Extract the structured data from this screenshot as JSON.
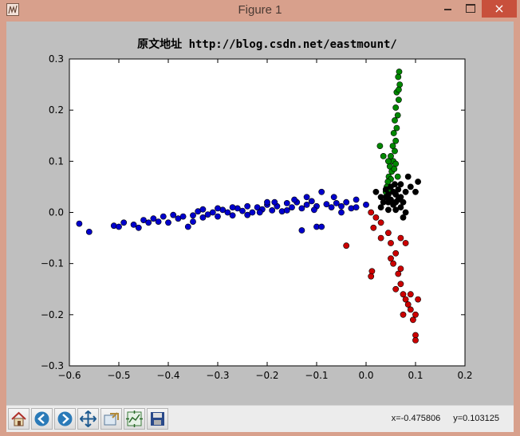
{
  "window": {
    "title": "Figure 1",
    "close_symbol": "×",
    "app_icon": "matplotlib-figure-icon"
  },
  "toolbar": {
    "buttons": [
      {
        "name": "home-button",
        "icon": "home-icon",
        "label": "Home"
      },
      {
        "name": "back-button",
        "icon": "back-arrow-icon",
        "label": "Back"
      },
      {
        "name": "forward-button",
        "icon": "forward-arrow-icon",
        "label": "Forward"
      },
      {
        "name": "pan-button",
        "icon": "pan-arrows-icon",
        "label": "Pan"
      },
      {
        "name": "zoom-button",
        "icon": "zoom-rect-icon",
        "label": "Zoom"
      },
      {
        "name": "subplots-button",
        "icon": "subplots-config-icon",
        "label": "Configure subplots"
      },
      {
        "name": "save-button",
        "icon": "floppy-disk-icon",
        "label": "Save"
      }
    ],
    "coord_x": "x=-0.475806",
    "coord_y": "y=0.103125"
  },
  "chart_data": {
    "type": "scatter",
    "title": "原文地址 http://blog.csdn.net/eastmount/",
    "xlabel": "",
    "ylabel": "",
    "xlim": [
      -0.6,
      0.2
    ],
    "ylim": [
      -0.3,
      0.3
    ],
    "xticks": [
      -0.6,
      -0.5,
      -0.4,
      -0.3,
      -0.2,
      -0.1,
      0.0,
      0.1,
      0.2
    ],
    "xtick_labels": [
      "−0.6",
      "−0.5",
      "−0.4",
      "−0.3",
      "−0.2",
      "−0.1",
      "0.0",
      "0.1",
      "0.2"
    ],
    "yticks": [
      -0.3,
      -0.2,
      -0.1,
      0.0,
      0.1,
      0.2,
      0.3
    ],
    "ytick_labels": [
      "−0.3",
      "−0.2",
      "−0.1",
      "0.0",
      "0.1",
      "0.2",
      "0.3"
    ],
    "grid": false,
    "legend": "none",
    "series": [
      {
        "color": "#0000cc",
        "points": [
          [
            -0.58,
            -0.022
          ],
          [
            -0.56,
            -0.038
          ],
          [
            -0.51,
            -0.026
          ],
          [
            -0.5,
            -0.028
          ],
          [
            -0.49,
            -0.02
          ],
          [
            -0.47,
            -0.024
          ],
          [
            -0.46,
            -0.03
          ],
          [
            -0.45,
            -0.015
          ],
          [
            -0.44,
            -0.02
          ],
          [
            -0.43,
            -0.012
          ],
          [
            -0.42,
            -0.018
          ],
          [
            -0.41,
            -0.008
          ],
          [
            -0.4,
            -0.02
          ],
          [
            -0.39,
            -0.005
          ],
          [
            -0.38,
            -0.012
          ],
          [
            -0.37,
            -0.008
          ],
          [
            -0.36,
            -0.028
          ],
          [
            -0.35,
            -0.006
          ],
          [
            -0.34,
            0.002
          ],
          [
            -0.33,
            -0.01
          ],
          [
            -0.32,
            -0.004
          ],
          [
            -0.31,
            0.0
          ],
          [
            -0.3,
            -0.008
          ],
          [
            -0.29,
            0.005
          ],
          [
            -0.28,
            0.0
          ],
          [
            -0.27,
            -0.006
          ],
          [
            -0.26,
            0.008
          ],
          [
            -0.25,
            0.003
          ],
          [
            -0.24,
            0.012
          ],
          [
            -0.23,
            0.0
          ],
          [
            -0.22,
            0.01
          ],
          [
            -0.21,
            0.006
          ],
          [
            -0.2,
            0.015
          ],
          [
            -0.19,
            0.004
          ],
          [
            -0.18,
            0.012
          ],
          [
            -0.17,
            0.002
          ],
          [
            -0.16,
            0.018
          ],
          [
            -0.15,
            0.01
          ],
          [
            -0.14,
            0.02
          ],
          [
            -0.13,
            0.008
          ],
          [
            -0.12,
            0.015
          ],
          [
            -0.11,
            0.022
          ],
          [
            -0.1,
            0.012
          ],
          [
            -0.09,
            0.04
          ],
          [
            -0.08,
            0.016
          ],
          [
            -0.07,
            0.01
          ],
          [
            -0.06,
            0.018
          ],
          [
            -0.05,
            0.012
          ],
          [
            -0.04,
            0.02
          ],
          [
            -0.03,
            0.008
          ],
          [
            -0.02,
            0.01
          ],
          [
            0.0,
            0.015
          ],
          [
            -0.13,
            -0.035
          ],
          [
            -0.1,
            -0.028
          ],
          [
            -0.09,
            -0.028
          ],
          [
            -0.24,
            -0.005
          ],
          [
            -0.3,
            0.008
          ],
          [
            -0.35,
            -0.018
          ],
          [
            -0.2,
            0.02
          ],
          [
            -0.16,
            0.004
          ],
          [
            -0.12,
            0.03
          ],
          [
            -0.27,
            0.01
          ],
          [
            -0.33,
            0.006
          ],
          [
            -0.05,
            0.0
          ],
          [
            -0.02,
            0.025
          ],
          [
            -0.215,
            0.0
          ],
          [
            -0.185,
            0.02
          ],
          [
            -0.145,
            0.025
          ],
          [
            -0.105,
            0.005
          ],
          [
            -0.065,
            0.03
          ]
        ]
      },
      {
        "color": "#008800",
        "points": [
          [
            0.067,
            0.275
          ],
          [
            0.065,
            0.265
          ],
          [
            0.068,
            0.25
          ],
          [
            0.062,
            0.235
          ],
          [
            0.066,
            0.22
          ],
          [
            0.06,
            0.205
          ],
          [
            0.064,
            0.19
          ],
          [
            0.058,
            0.18
          ],
          [
            0.062,
            0.165
          ],
          [
            0.056,
            0.155
          ],
          [
            0.06,
            0.14
          ],
          [
            0.054,
            0.13
          ],
          [
            0.058,
            0.12
          ],
          [
            0.05,
            0.11
          ],
          [
            0.055,
            0.1
          ],
          [
            0.048,
            0.09
          ],
          [
            0.052,
            0.08
          ],
          [
            0.046,
            0.07
          ],
          [
            0.05,
            0.065
          ],
          [
            0.044,
            0.06
          ],
          [
            0.042,
            0.05
          ],
          [
            0.048,
            0.045
          ],
          [
            0.04,
            0.04
          ],
          [
            0.028,
            0.13
          ],
          [
            0.035,
            0.11
          ],
          [
            0.06,
            0.095
          ],
          [
            0.057,
            0.085
          ],
          [
            0.064,
            0.07
          ],
          [
            0.045,
            0.1
          ],
          [
            0.066,
            0.24
          ]
        ]
      },
      {
        "color": "#000000",
        "points": [
          [
            0.05,
            0.05
          ],
          [
            0.055,
            0.04
          ],
          [
            0.06,
            0.035
          ],
          [
            0.065,
            0.045
          ],
          [
            0.07,
            0.03
          ],
          [
            0.045,
            0.02
          ],
          [
            0.04,
            0.03
          ],
          [
            0.035,
            0.02
          ],
          [
            0.05,
            0.025
          ],
          [
            0.06,
            0.02
          ],
          [
            0.075,
            0.02
          ],
          [
            0.08,
            0.04
          ],
          [
            0.085,
            0.07
          ],
          [
            0.09,
            0.05
          ],
          [
            0.1,
            0.04
          ],
          [
            0.105,
            0.06
          ],
          [
            0.02,
            0.04
          ],
          [
            0.03,
            0.01
          ],
          [
            0.045,
            0.005
          ],
          [
            0.06,
            0.005
          ],
          [
            0.07,
            0.01
          ],
          [
            0.08,
            0.0
          ],
          [
            0.075,
            -0.01
          ],
          [
            0.055,
            0.015
          ],
          [
            0.065,
            0.025
          ],
          [
            0.045,
            0.035
          ],
          [
            0.04,
            0.045
          ],
          [
            0.058,
            0.055
          ],
          [
            0.07,
            0.055
          ],
          [
            0.03,
            0.03
          ]
        ]
      },
      {
        "color": "#cc0000",
        "points": [
          [
            0.01,
            0.0
          ],
          [
            0.02,
            -0.01
          ],
          [
            0.03,
            -0.02
          ],
          [
            0.045,
            -0.04
          ],
          [
            0.05,
            -0.06
          ],
          [
            0.06,
            -0.08
          ],
          [
            0.055,
            -0.1
          ],
          [
            0.065,
            -0.12
          ],
          [
            0.07,
            -0.14
          ],
          [
            0.075,
            -0.16
          ],
          [
            0.08,
            -0.17
          ],
          [
            0.085,
            -0.18
          ],
          [
            0.09,
            -0.19
          ],
          [
            0.1,
            -0.2
          ],
          [
            0.095,
            -0.21
          ],
          [
            0.1,
            -0.24
          ],
          [
            0.1,
            -0.25
          ],
          [
            0.05,
            -0.09
          ],
          [
            0.03,
            -0.05
          ],
          [
            0.015,
            -0.03
          ],
          [
            -0.04,
            -0.065
          ],
          [
            0.012,
            -0.115
          ],
          [
            0.01,
            -0.125
          ],
          [
            0.07,
            -0.05
          ],
          [
            0.08,
            -0.06
          ],
          [
            0.06,
            -0.15
          ],
          [
            0.07,
            -0.11
          ],
          [
            0.105,
            -0.17
          ],
          [
            0.09,
            -0.16
          ],
          [
            0.075,
            -0.2
          ]
        ]
      }
    ]
  }
}
